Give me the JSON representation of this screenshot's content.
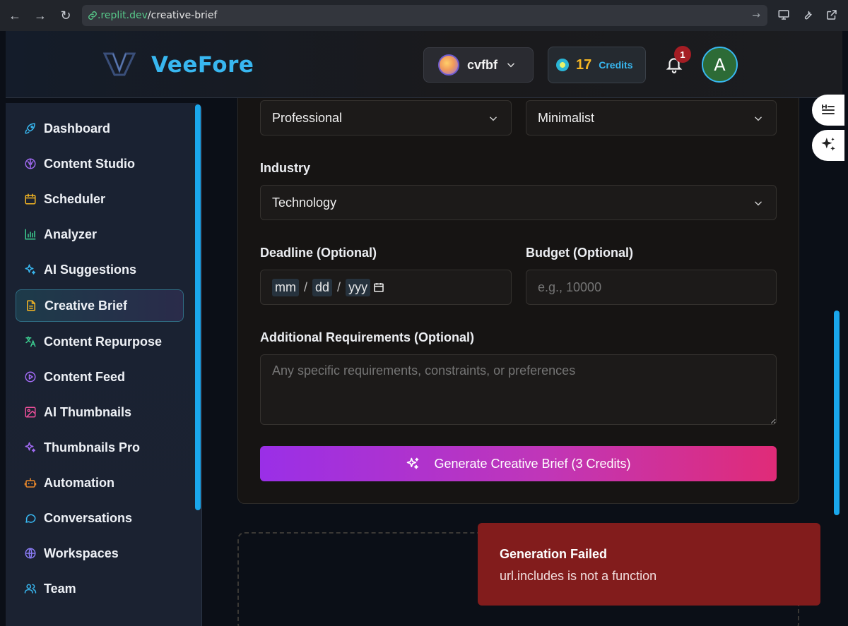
{
  "browser": {
    "url_domain": ".replit.dev",
    "url_path": "/creative-brief"
  },
  "header": {
    "logo_text": "VeeFore",
    "workspace_name": "cvfbf",
    "credits_count": "17",
    "credits_label": "Credits",
    "notification_count": "1",
    "avatar_initial": "A"
  },
  "sidebar": {
    "items": [
      {
        "label": "Dashboard",
        "icon": "rocket-icon"
      },
      {
        "label": "Content Studio",
        "icon": "brain-icon"
      },
      {
        "label": "Scheduler",
        "icon": "calendar-icon"
      },
      {
        "label": "Analyzer",
        "icon": "bar-chart-icon"
      },
      {
        "label": "AI Suggestions",
        "icon": "sparkles-icon"
      },
      {
        "label": "Creative Brief",
        "icon": "document-icon",
        "active": true
      },
      {
        "label": "Content Repurpose",
        "icon": "translate-icon"
      },
      {
        "label": "Content Feed",
        "icon": "play-circle-icon"
      },
      {
        "label": "AI Thumbnails",
        "icon": "image-icon"
      },
      {
        "label": "Thumbnails Pro",
        "icon": "sparkles-icon"
      },
      {
        "label": "Automation",
        "icon": "bot-icon"
      },
      {
        "label": "Conversations",
        "icon": "message-icon"
      },
      {
        "label": "Workspaces",
        "icon": "globe-icon"
      },
      {
        "label": "Team",
        "icon": "users-icon"
      }
    ]
  },
  "form": {
    "tone_value": "Professional",
    "style_value": "Minimalist",
    "industry_label": "Industry",
    "industry_value": "Technology",
    "deadline_label": "Deadline (Optional)",
    "deadline_mm": "mm",
    "deadline_dd": "dd",
    "deadline_yyyy": "yyy",
    "budget_label": "Budget (Optional)",
    "budget_placeholder": "e.g., 10000",
    "requirements_label": "Additional Requirements (Optional)",
    "requirements_placeholder": "Any specific requirements, constraints, or preferences",
    "generate_label": "Generate Creative Brief (3 Credits)"
  },
  "toast": {
    "title": "Generation Failed",
    "message": "url.includes is not a function"
  },
  "colors": {
    "accent": "#38b7f0",
    "credits": "#f5b623",
    "error": "#821c1c"
  }
}
